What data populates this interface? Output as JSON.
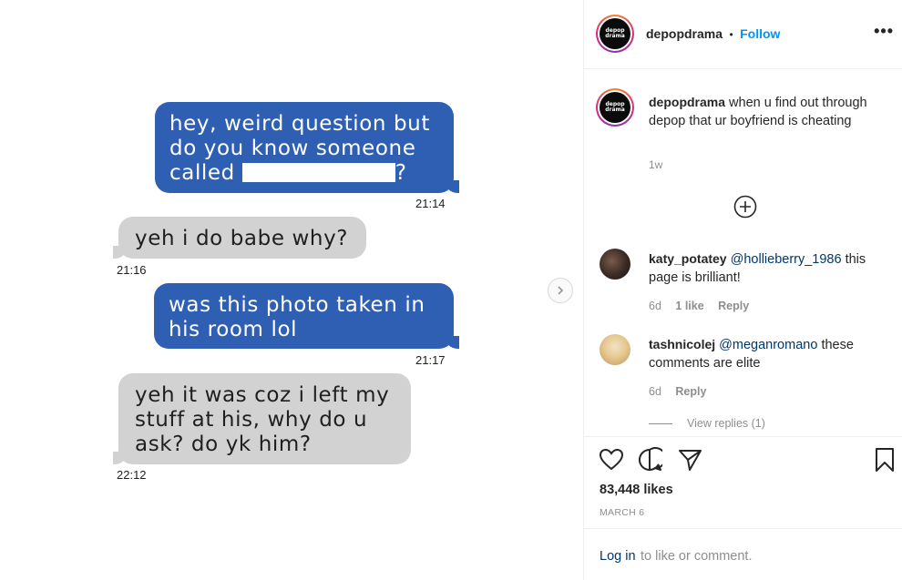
{
  "post_image": {
    "messages": [
      {
        "line1": "hey, weird question but",
        "line2": "do you know someone",
        "line3_prefix": "called",
        "line3_suffix": "?",
        "time": "21:14"
      },
      {
        "line1": "yeh i do babe why?",
        "time": "21:16"
      },
      {
        "line1": "was this photo taken in",
        "line2": "his room lol",
        "time": "21:17"
      },
      {
        "line1": "yeh it was coz i left my",
        "line2": "stuff at his, why do u",
        "line3": "ask? do yk him?",
        "time": "22:12"
      }
    ]
  },
  "header": {
    "avatar_text_line1": "depop",
    "avatar_text_line2": "drama",
    "username": "depopdrama",
    "separator": "•",
    "follow_label": "Follow",
    "more_label": "•••"
  },
  "caption": {
    "username": "depopdrama",
    "text": "when u find out through depop that ur boyfriend is cheating",
    "age": "1w"
  },
  "comments": [
    {
      "username": "katy_potatey",
      "mention": "@hollieberry_1986",
      "text": "this page is brilliant!",
      "age": "6d",
      "likes": "1 like",
      "reply_label": "Reply"
    },
    {
      "username": "tashnicolej",
      "mention": "@meganromano",
      "text": "these comments are elite",
      "age": "6d",
      "reply_label": "Reply",
      "view_replies": "View replies (1)"
    }
  ],
  "actions": {
    "likes": "83,448 likes",
    "date": "MARCH 6"
  },
  "login": {
    "link": "Log in",
    "text": "to like or comment."
  },
  "colors": {
    "outgoing_bubble": "#2f5fb3",
    "incoming_bubble": "#d2d2d2",
    "follow": "#0095f6",
    "mention": "#00376b"
  }
}
